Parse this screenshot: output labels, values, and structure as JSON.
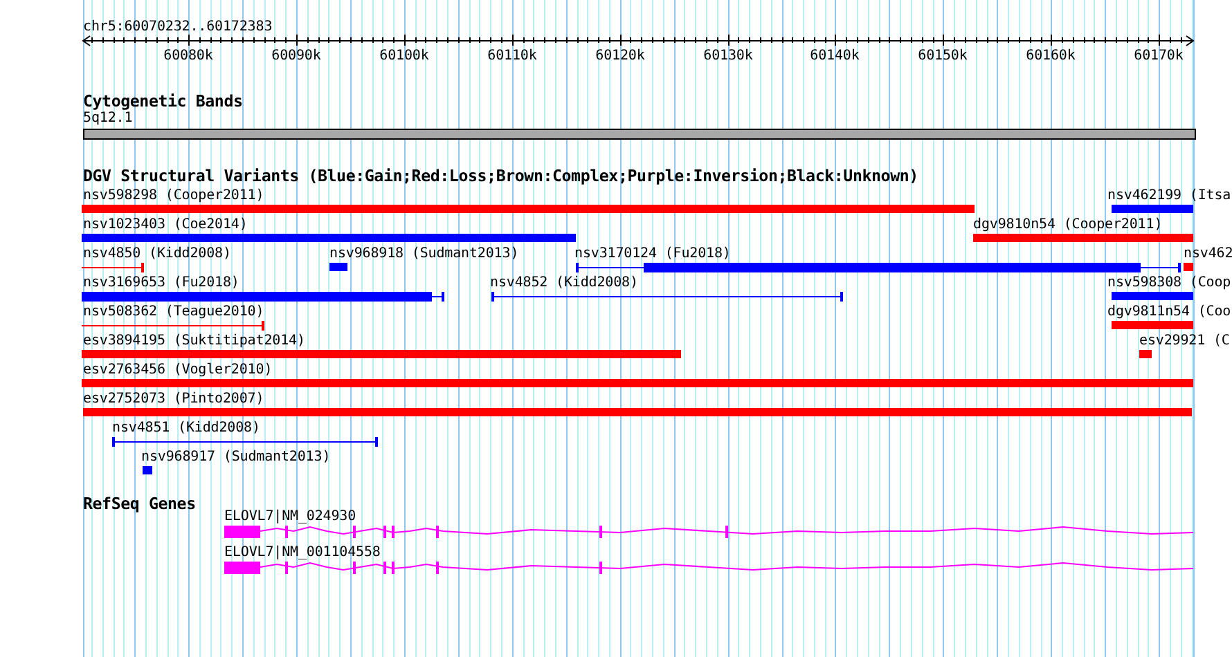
{
  "ruler": {
    "location": "chr5:60070232..60172383",
    "ticks": [
      "60080k",
      "60090k",
      "60100k",
      "60110k",
      "60120k",
      "60130k",
      "60140k",
      "60150k",
      "60160k",
      "60170k"
    ]
  },
  "cytoband": {
    "title": "Cytogenetic Bands",
    "band": "5q12.1"
  },
  "dgv": {
    "title": "DGV Structural Variants (Blue:Gain;Red:Loss;Brown:Complex;Purple:Inversion;Black:Unknown)",
    "variants": [
      {
        "label": "nsv598298 (Cooper2011)",
        "color": "#ff0000",
        "kind": "block"
      },
      {
        "label": "nsv462199 (Itsa",
        "color": "#0000ff",
        "kind": "block"
      },
      {
        "label": "nsv1023403 (Coe2014)",
        "color": "#0000ff",
        "kind": "block"
      },
      {
        "label": "dgv9810n54 (Cooper2011)",
        "color": "#ff0000",
        "kind": "block"
      },
      {
        "label": "nsv4850 (Kidd2008)",
        "color": "#ff0000",
        "kind": "range"
      },
      {
        "label": "nsv968918 (Sudmant2013)",
        "color": "#0000ff",
        "kind": "block"
      },
      {
        "label": "nsv3170124 (Fu2018)",
        "color": "#0000ff",
        "kind": "mixed"
      },
      {
        "label": "nsv462",
        "color": "#ff0000",
        "kind": "block"
      },
      {
        "label": "nsv3169653 (Fu2018)",
        "color": "#0000ff",
        "kind": "mixed"
      },
      {
        "label": "nsv4852 (Kidd2008)",
        "color": "#0000ff",
        "kind": "range"
      },
      {
        "label": "nsv598308 (Coop",
        "color": "#0000ff",
        "kind": "block"
      },
      {
        "label": "nsv508362 (Teague2010)",
        "color": "#ff0000",
        "kind": "range"
      },
      {
        "label": "dgv9811n54 (Coo",
        "color": "#ff0000",
        "kind": "block"
      },
      {
        "label": "esv3894195 (Suktitipat2014)",
        "color": "#ff0000",
        "kind": "block"
      },
      {
        "label": "esv29921 (C",
        "color": "#ff0000",
        "kind": "block"
      },
      {
        "label": "esv2763456 (Vogler2010)",
        "color": "#ff0000",
        "kind": "block"
      },
      {
        "label": "esv2752073 (Pinto2007)",
        "color": "#ff0000",
        "kind": "block"
      },
      {
        "label": "nsv4851 (Kidd2008)",
        "color": "#0000ff",
        "kind": "range"
      },
      {
        "label": "nsv968917 (Sudmant2013)",
        "color": "#0000ff",
        "kind": "block"
      }
    ]
  },
  "refseq": {
    "title": "RefSeq Genes",
    "genes": [
      {
        "label": "ELOVL7|NM_024930"
      },
      {
        "label": "ELOVL7|NM_001104558"
      }
    ]
  }
}
